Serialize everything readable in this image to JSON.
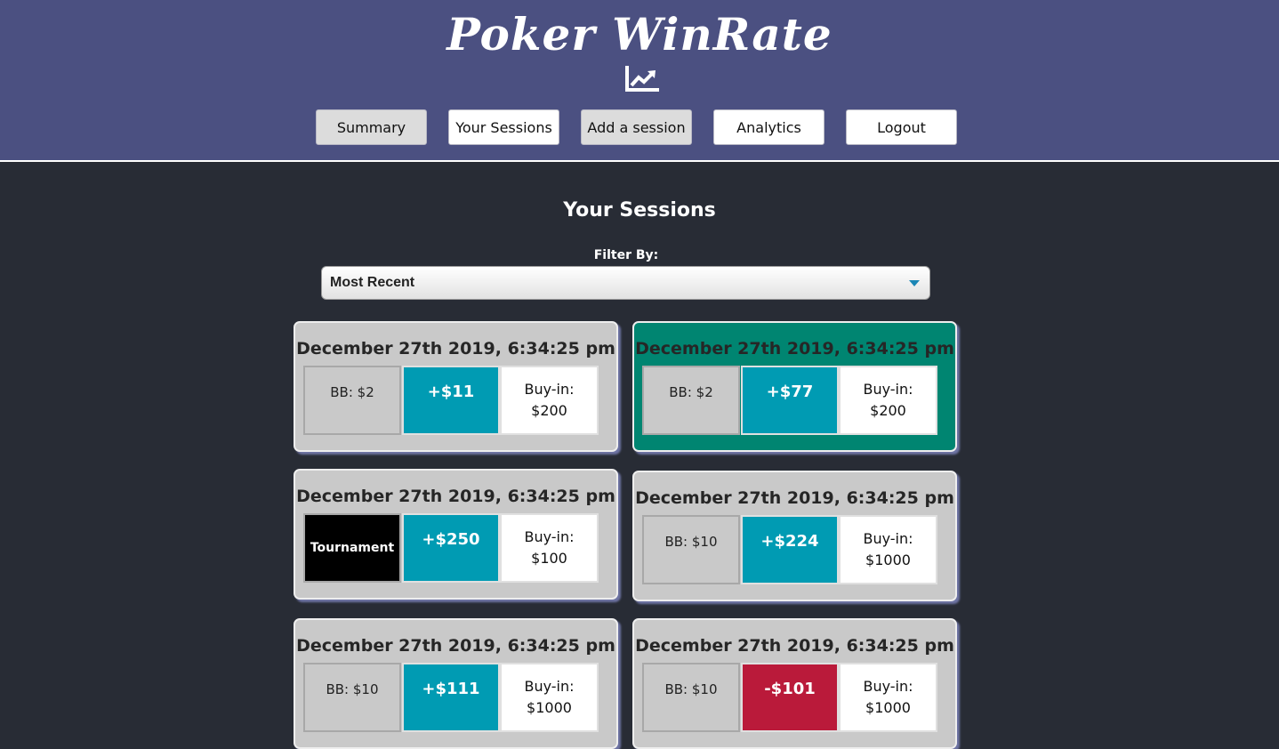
{
  "app": {
    "title": "Poker WinRate",
    "logo_icon": "line-chart-icon"
  },
  "nav": [
    {
      "label": "Summary"
    },
    {
      "label": "Your Sessions"
    },
    {
      "label": "Add a session"
    },
    {
      "label": "Analytics"
    },
    {
      "label": "Logout"
    }
  ],
  "page": {
    "heading": "Your Sessions",
    "filter_label": "Filter By:",
    "filter_value": "Most Recent"
  },
  "sessions": [
    {
      "date": "December 27th 2019, 6:34:25 pm",
      "stakes": "BB: $2",
      "profit": "+$11",
      "buyin_label": "Buy-in:",
      "buyin": "$200"
    },
    {
      "date": "December 27th 2019, 6:34:25 pm",
      "stakes": "BB: $2",
      "profit": "+$77",
      "buyin_label": "Buy-in:",
      "buyin": "$200"
    },
    {
      "date": "December 27th 2019, 6:34:25 pm",
      "stakes": "Tournament",
      "profit": "+$250",
      "buyin_label": "Buy-in:",
      "buyin": "$100"
    },
    {
      "date": "December 27th 2019, 6:34:25 pm",
      "stakes": "BB: $10",
      "profit": "+$224",
      "buyin_label": "Buy-in:",
      "buyin": "$1000"
    },
    {
      "date": "December 27th 2019, 6:34:25 pm",
      "stakes": "BB: $10",
      "profit": "+$111",
      "buyin_label": "Buy-in:",
      "buyin": "$1000"
    },
    {
      "date": "December 27th 2019, 6:34:25 pm",
      "stakes": "BB: $10",
      "profit": "-$101",
      "buyin_label": "Buy-in:",
      "buyin": "$1000"
    }
  ],
  "colors": {
    "header_bg": "#4b5081",
    "page_bg": "#282c35",
    "card_bg": "#c9c9c9",
    "card_selected_bg": "#008571",
    "profit_positive": "#009bb3",
    "profit_negative": "#ba1a3a",
    "tournament_bg": "#000000"
  }
}
